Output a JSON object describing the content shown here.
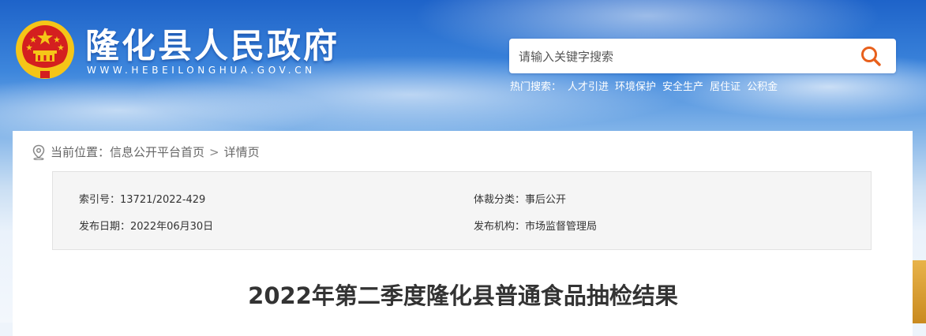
{
  "header": {
    "site_title": "隆化县人民政府",
    "site_url": "WWW.HEBEILONGHUA.GOV.CN",
    "search": {
      "placeholder": "请输入关键字搜索"
    },
    "hot_search": {
      "label": "热门搜索：",
      "items": [
        "人才引进",
        "环境保护",
        "安全生产",
        "居住证",
        "公积金"
      ]
    }
  },
  "breadcrumb": {
    "label": "当前位置：",
    "home": "信息公开平台首页",
    "separator": ">",
    "current": "详情页"
  },
  "meta": {
    "index_no": "索引号：13721/2022-429",
    "publish_date": "发布日期：2022年06月30日",
    "genre": "体裁分类：事后公开",
    "agency": "发布机构：市场监督管理局"
  },
  "article": {
    "title": "2022年第二季度隆化县普通食品抽检结果"
  },
  "colors": {
    "search_icon": "#e8601c",
    "emblem_red": "#d41f1f",
    "emblem_gold": "#f5c518"
  }
}
